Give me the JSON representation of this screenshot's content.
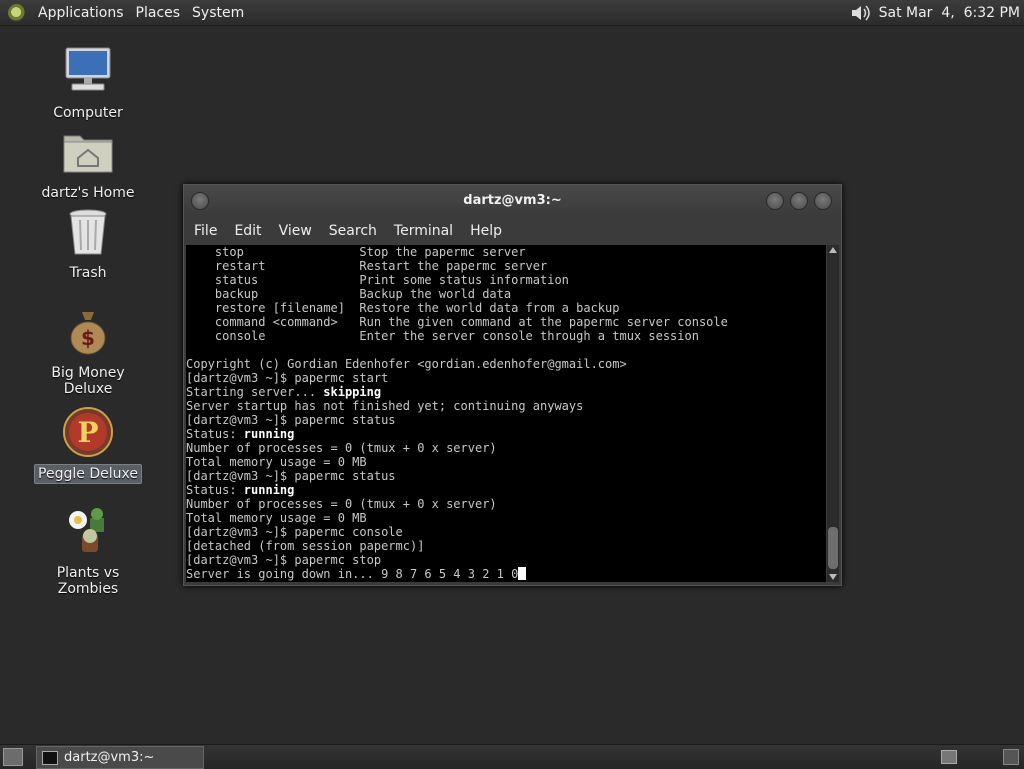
{
  "top_panel": {
    "menus": [
      "Applications",
      "Places",
      "System"
    ],
    "clock": "Sat Mar  4,  6:32 PM"
  },
  "desktop": {
    "icons": [
      {
        "label": "Computer"
      },
      {
        "label": "dartz's Home"
      },
      {
        "label": "Trash"
      },
      {
        "label": "Big Money Deluxe"
      },
      {
        "label": "Peggle Deluxe"
      },
      {
        "label": "Plants vs Zombies"
      }
    ]
  },
  "terminal": {
    "title": "dartz@vm3:~",
    "menus": [
      "File",
      "Edit",
      "View",
      "Search",
      "Terminal",
      "Help"
    ],
    "help_lines": [
      "    stop                Stop the papermc server",
      "    restart             Restart the papermc server",
      "    status              Print some status information",
      "    backup              Backup the world data",
      "    restore [filename]  Restore the world data from a backup",
      "    command <command>   Run the given command at the papermc server console",
      "    console             Enter the server console through a tmux session"
    ],
    "copyright": "Copyright (c) Gordian Edenhofer <gordian.edenhofer@gmail.com>",
    "prompt": "[dartz@vm3 ~]$ ",
    "cmd_start": "papermc start",
    "starting_prefix": "Starting server... ",
    "starting_status": "skipping",
    "startup_note": "Server startup has not finished yet; continuing anyways",
    "cmd_status": "papermc status",
    "status_prefix": "Status: ",
    "status_value": "running",
    "processes": "Number of processes = 0 (tmux + 0 x server)",
    "memory": "Total memory usage = 0 MB",
    "cmd_console": "papermc console",
    "detached": "[detached (from session papermc)]",
    "cmd_stop": "papermc stop",
    "shutdown": "Server is going down in... 9 8 7 6 5 4 3 2 1 0"
  },
  "taskbar": {
    "task_label": "dartz@vm3:~"
  }
}
